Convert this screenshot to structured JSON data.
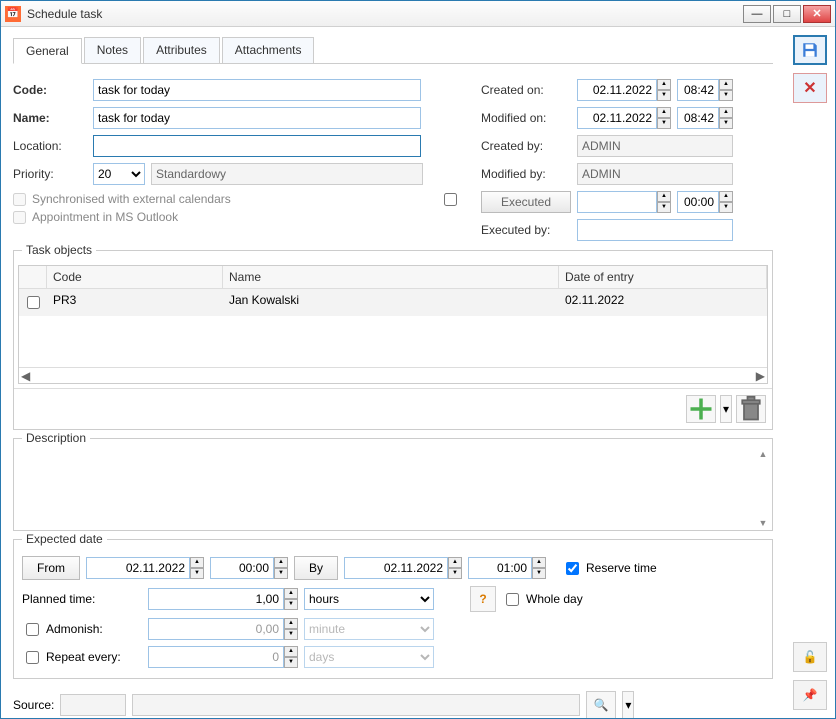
{
  "window": {
    "title": "Schedule task"
  },
  "tabs": {
    "general": "General",
    "notes": "Notes",
    "attributes": "Attributes",
    "attachments": "Attachments"
  },
  "labels": {
    "code": "Code:",
    "name": "Name:",
    "location": "Location:",
    "priority": "Priority:",
    "sync": "Synchronised with external calendars",
    "outlook": "Appointment in MS Outlook",
    "created_on": "Created on:",
    "modified_on": "Modified on:",
    "created_by": "Created by:",
    "modified_by": "Modified by:",
    "executed": "Executed",
    "executed_by": "Executed by:",
    "task_objects": "Task objects",
    "description": "Description",
    "expected_date": "Expected date",
    "from": "From",
    "by": "By",
    "reserve_time": "Reserve time",
    "planned_time": "Planned time:",
    "whole_day": "Whole day",
    "admonish": "Admonish:",
    "repeat_every": "Repeat every:",
    "source": "Source:"
  },
  "fields": {
    "code": "task for today",
    "name": "task for today",
    "location": "",
    "priority_value": "20",
    "priority_text": "Standardowy",
    "created_on_date": "02.11.2022",
    "created_on_time": "08:42",
    "modified_on_date": "02.11.2022",
    "modified_on_time": "08:42",
    "created_by": "ADMIN",
    "modified_by": "ADMIN",
    "executed_date": "",
    "executed_time": "00:00",
    "executed_by": "",
    "from_date": "02.11.2022",
    "from_time": "00:00",
    "by_date": "02.11.2022",
    "by_time": "01:00",
    "reserve_time_checked": true,
    "whole_day_checked": false,
    "planned_time_value": "1,00",
    "planned_time_unit": "hours",
    "admonish_checked": false,
    "admonish_value": "0,00",
    "admonish_unit": "minute",
    "repeat_checked": false,
    "repeat_value": "0",
    "repeat_unit": "days",
    "source_code": "",
    "source_name": ""
  },
  "grid": {
    "col_code": "Code",
    "col_name": "Name",
    "col_date": "Date of entry",
    "rows": [
      {
        "code": "PR3",
        "name": "Jan Kowalski",
        "date": "02.11.2022"
      }
    ]
  },
  "units": {
    "hours": "hours",
    "minute": "minute",
    "days": "days"
  }
}
